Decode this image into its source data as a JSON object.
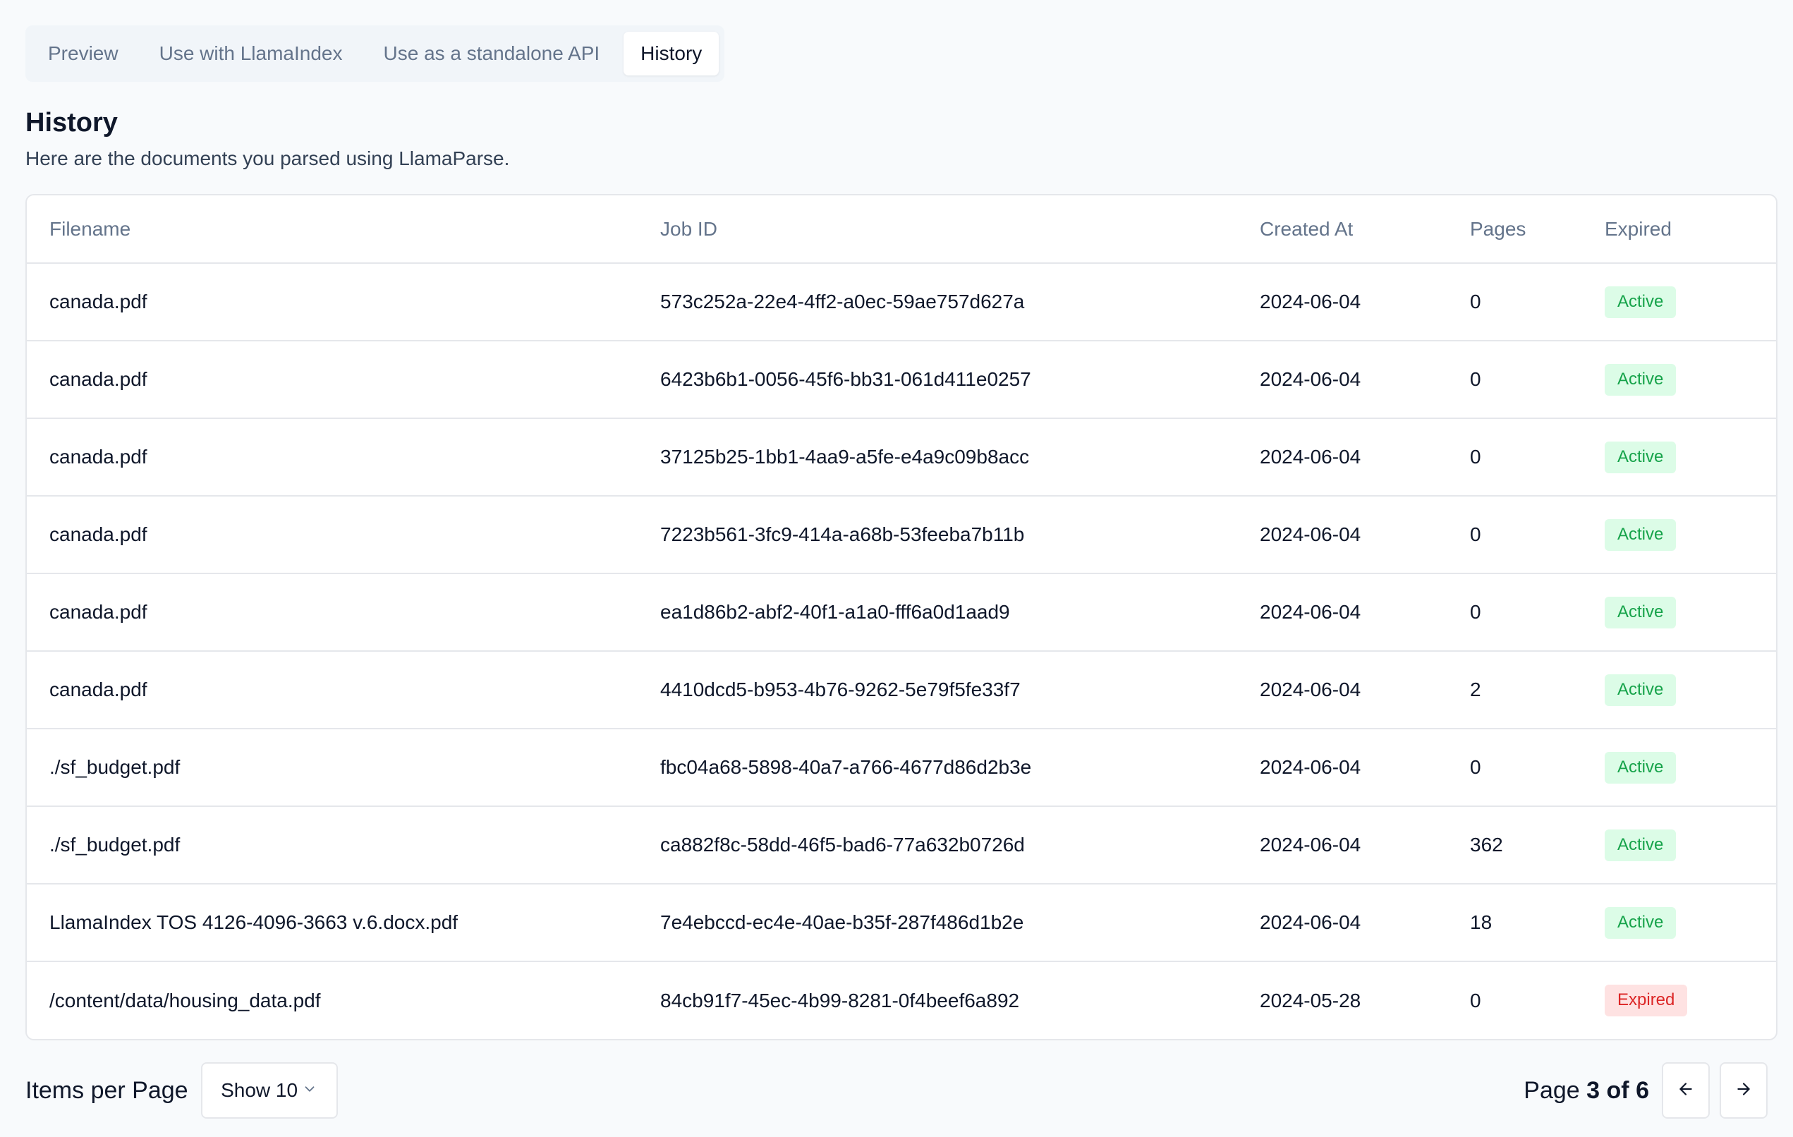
{
  "tabs": [
    {
      "label": "Preview",
      "active": false
    },
    {
      "label": "Use with LlamaIndex",
      "active": false
    },
    {
      "label": "Use as a standalone API",
      "active": false
    },
    {
      "label": "History",
      "active": true
    }
  ],
  "history": {
    "title": "History",
    "description": "Here are the documents you parsed using LlamaParse."
  },
  "table": {
    "columns": [
      "Filename",
      "Job ID",
      "Created At",
      "Pages",
      "Expired"
    ],
    "rows": [
      {
        "filename": "canada.pdf",
        "job_id": "573c252a-22e4-4ff2-a0ec-59ae757d627a",
        "created_at": "2024-06-04",
        "pages": "0",
        "status": "Active"
      },
      {
        "filename": "canada.pdf",
        "job_id": "6423b6b1-0056-45f6-bb31-061d411e0257",
        "created_at": "2024-06-04",
        "pages": "0",
        "status": "Active"
      },
      {
        "filename": "canada.pdf",
        "job_id": "37125b25-1bb1-4aa9-a5fe-e4a9c09b8acc",
        "created_at": "2024-06-04",
        "pages": "0",
        "status": "Active"
      },
      {
        "filename": "canada.pdf",
        "job_id": "7223b561-3fc9-414a-a68b-53feeba7b11b",
        "created_at": "2024-06-04",
        "pages": "0",
        "status": "Active"
      },
      {
        "filename": "canada.pdf",
        "job_id": "ea1d86b2-abf2-40f1-a1a0-fff6a0d1aad9",
        "created_at": "2024-06-04",
        "pages": "0",
        "status": "Active"
      },
      {
        "filename": "canada.pdf",
        "job_id": "4410dcd5-b953-4b76-9262-5e79f5fe33f7",
        "created_at": "2024-06-04",
        "pages": "2",
        "status": "Active"
      },
      {
        "filename": "./sf_budget.pdf",
        "job_id": "fbc04a68-5898-40a7-a766-4677d86d2b3e",
        "created_at": "2024-06-04",
        "pages": "0",
        "status": "Active"
      },
      {
        "filename": "./sf_budget.pdf",
        "job_id": "ca882f8c-58dd-46f5-bad6-77a632b0726d",
        "created_at": "2024-06-04",
        "pages": "362",
        "status": "Active"
      },
      {
        "filename": "LlamaIndex TOS 4126-4096-3663 v.6.docx.pdf",
        "job_id": "7e4ebccd-ec4e-40ae-b35f-287f486d1b2e",
        "created_at": "2024-06-04",
        "pages": "18",
        "status": "Active"
      },
      {
        "filename": "/content/data/housing_data.pdf",
        "job_id": "84cb91f7-45ec-4b99-8281-0f4beef6a892",
        "created_at": "2024-05-28",
        "pages": "0",
        "status": "Expired"
      }
    ]
  },
  "pagination": {
    "items_per_page_label": "Items per Page",
    "select_value": "Show 10",
    "page_word": "Page",
    "current_page": "3",
    "of_word": "of",
    "total_pages": "6"
  },
  "icons": {
    "select": "chevron-down-icon",
    "prev": "arrow-left-icon",
    "next": "arrow-right-icon"
  },
  "colors": {
    "active_text": "#16a34a",
    "active_bg": "#dcfce7",
    "expired_text": "#dc2626",
    "expired_bg": "#fee2e2"
  }
}
